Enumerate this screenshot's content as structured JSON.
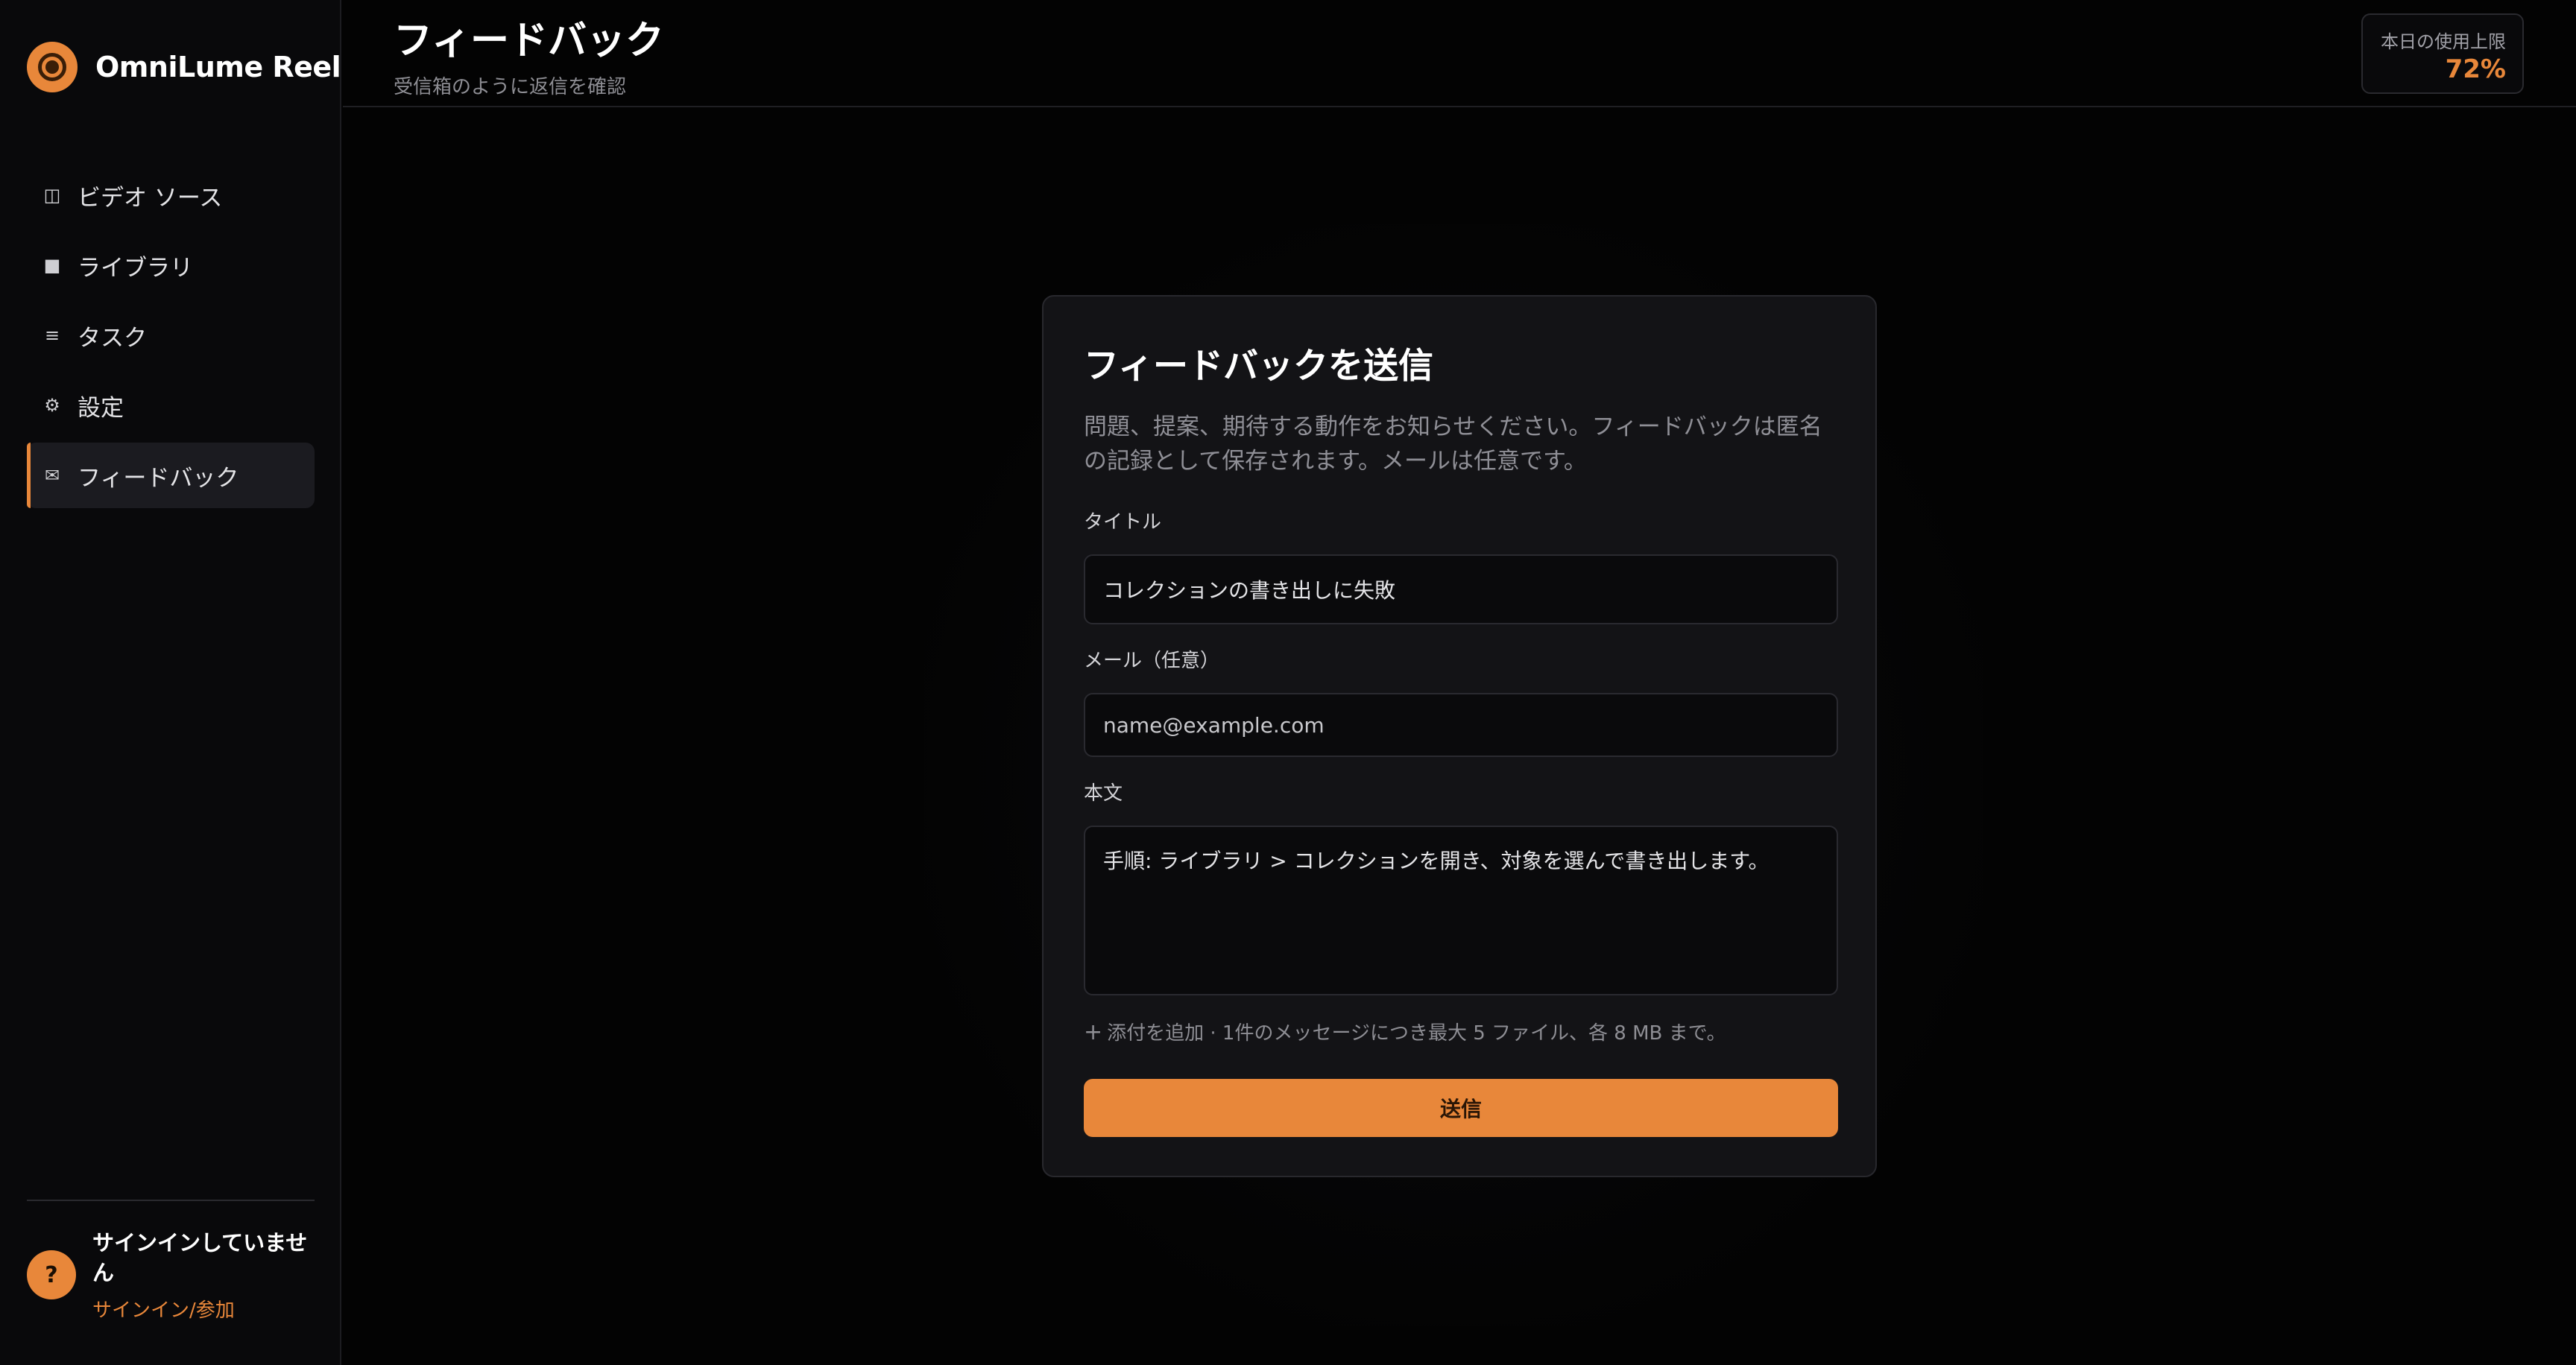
{
  "app": {
    "name": "OmniLume Reel"
  },
  "sidebar": {
    "items": [
      {
        "label": "ビデオ ソース",
        "icon": "◫"
      },
      {
        "label": "ライブラリ",
        "icon": "■"
      },
      {
        "label": "タスク",
        "icon": "≡"
      },
      {
        "label": "設定",
        "icon": "⚙"
      },
      {
        "label": "フィードバック",
        "icon": "✉",
        "active": true
      }
    ],
    "account": {
      "avatar": "?",
      "status": "サインインしていません",
      "link": "サインイン/参加"
    }
  },
  "header": {
    "title": "フィードバック",
    "subtitle": "受信箱のように返信を確認",
    "usage": {
      "label": "本日の使用上限",
      "value": "72%"
    }
  },
  "feedback_form": {
    "title": "フィードバックを送信",
    "description": "問題、提案、期待する動作をお知らせください。フィードバックは匿名の記録として保存されます。メールは任意です。",
    "title_label": "タイトル",
    "title_value": "コレクションの書き出しに失敗",
    "email_label": "メール（任意）",
    "email_placeholder": "name@example.com",
    "body_label": "本文",
    "body_value": "手順: ライブラリ > コレクションを開き、対象を選んで書き出します。",
    "attach_plus": "+",
    "attach_text": "添付を追加 · 1件のメッセージにつき最大 5 ファイル、各 8 MB まで。",
    "submit_label": "送信"
  },
  "colors": {
    "accent": "#e8873a",
    "background": "#030303",
    "card": "#131316"
  }
}
